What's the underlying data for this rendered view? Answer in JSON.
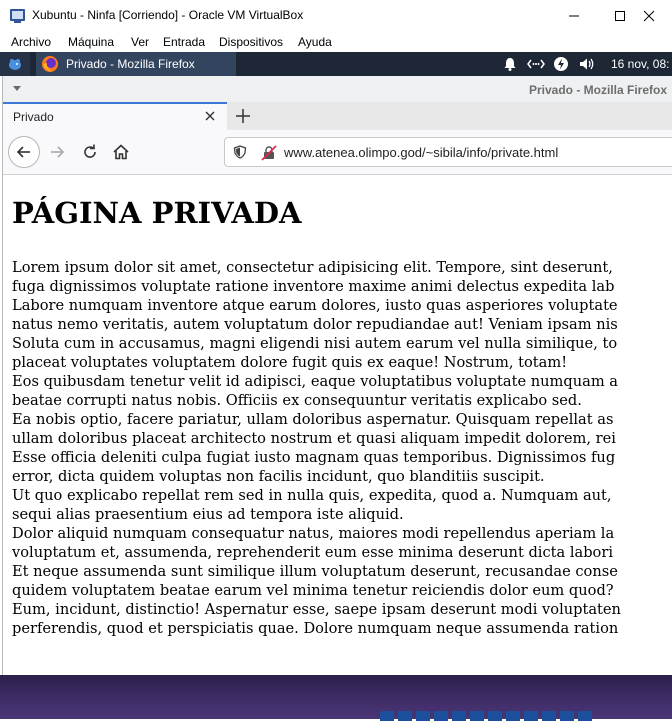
{
  "virtualbox": {
    "title": "Xubuntu - Ninfa [Corriendo] - Oracle VM VirtualBox",
    "menu": [
      "Archivo",
      "Máquina",
      "Ver",
      "Entrada",
      "Dispositivos",
      "Ayuda"
    ]
  },
  "panel": {
    "task_label": "Privado - Mozilla Firefox",
    "clock": "16 nov, 08:",
    "tray_icons": [
      "bell-icon",
      "network-icon",
      "power-icon",
      "volume-icon"
    ]
  },
  "firefox": {
    "window_title": "Privado - Mozilla Firefox",
    "tab_label": "Privado",
    "url": "www.atenea.olimpo.god/~sibila/info/private.html"
  },
  "page": {
    "heading": "PÁGINA PRIVADA",
    "lines": [
      "Lorem ipsum dolor sit amet, consectetur adipisicing elit. Tempore, sint deserunt,",
      "fuga dignissimos voluptate ratione inventore maxime animi delectus expedita lab",
      "Labore numquam inventore atque earum dolores, iusto quas asperiores voluptate",
      "natus nemo veritatis, autem voluptatum dolor repudiandae aut! Veniam ipsam nis",
      "Soluta cum in accusamus, magni eligendi nisi autem earum vel nulla similique, to",
      "placeat voluptates voluptatem dolore fugit quis ex eaque! Nostrum, totam!",
      "Eos quibusdam tenetur velit id adipisci, eaque voluptatibus voluptate numquam a",
      "beatae corrupti natus nobis. Officiis ex consequuntur veritatis explicabo sed.",
      "Ea nobis optio, facere pariatur, ullam doloribus aspernatur. Quisquam repellat as",
      "ullam doloribus placeat architecto nostrum et quasi aliquam impedit dolorem, rei",
      "Esse officia deleniti culpa fugiat iusto magnam quas temporibus. Dignissimos fug",
      "error, dicta quidem voluptas non facilis incidunt, quo blanditiis suscipit.",
      "Ut quo explicabo repellat rem sed in nulla quis, expedita, quod a. Numquam aut,",
      "sequi alias praesentium eius ad tempora iste aliquid.",
      "Dolor aliquid numquam consequatur natus, maiores modi repellendus aperiam la",
      "voluptatum et, assumenda, reprehenderit eum esse minima deserunt dicta labori",
      "Et neque assumenda sunt similique illum voluptatum deserunt, recusandae conse",
      "quidem voluptatem beatae earum vel minima tenetur reiciendis dolor eum quod?",
      "Eum, incidunt, distinctio! Aspernatur esse, saepe ipsam deserunt modi voluptaten",
      "perferendis, quod et perspiciatis quae. Dolore numquam neque assumenda ration"
    ]
  },
  "colors": {
    "panel_bg": "#1d2735",
    "active_task": "#33455e",
    "tab_accent": "#3c78d8",
    "desktop": "#3c2b63"
  }
}
